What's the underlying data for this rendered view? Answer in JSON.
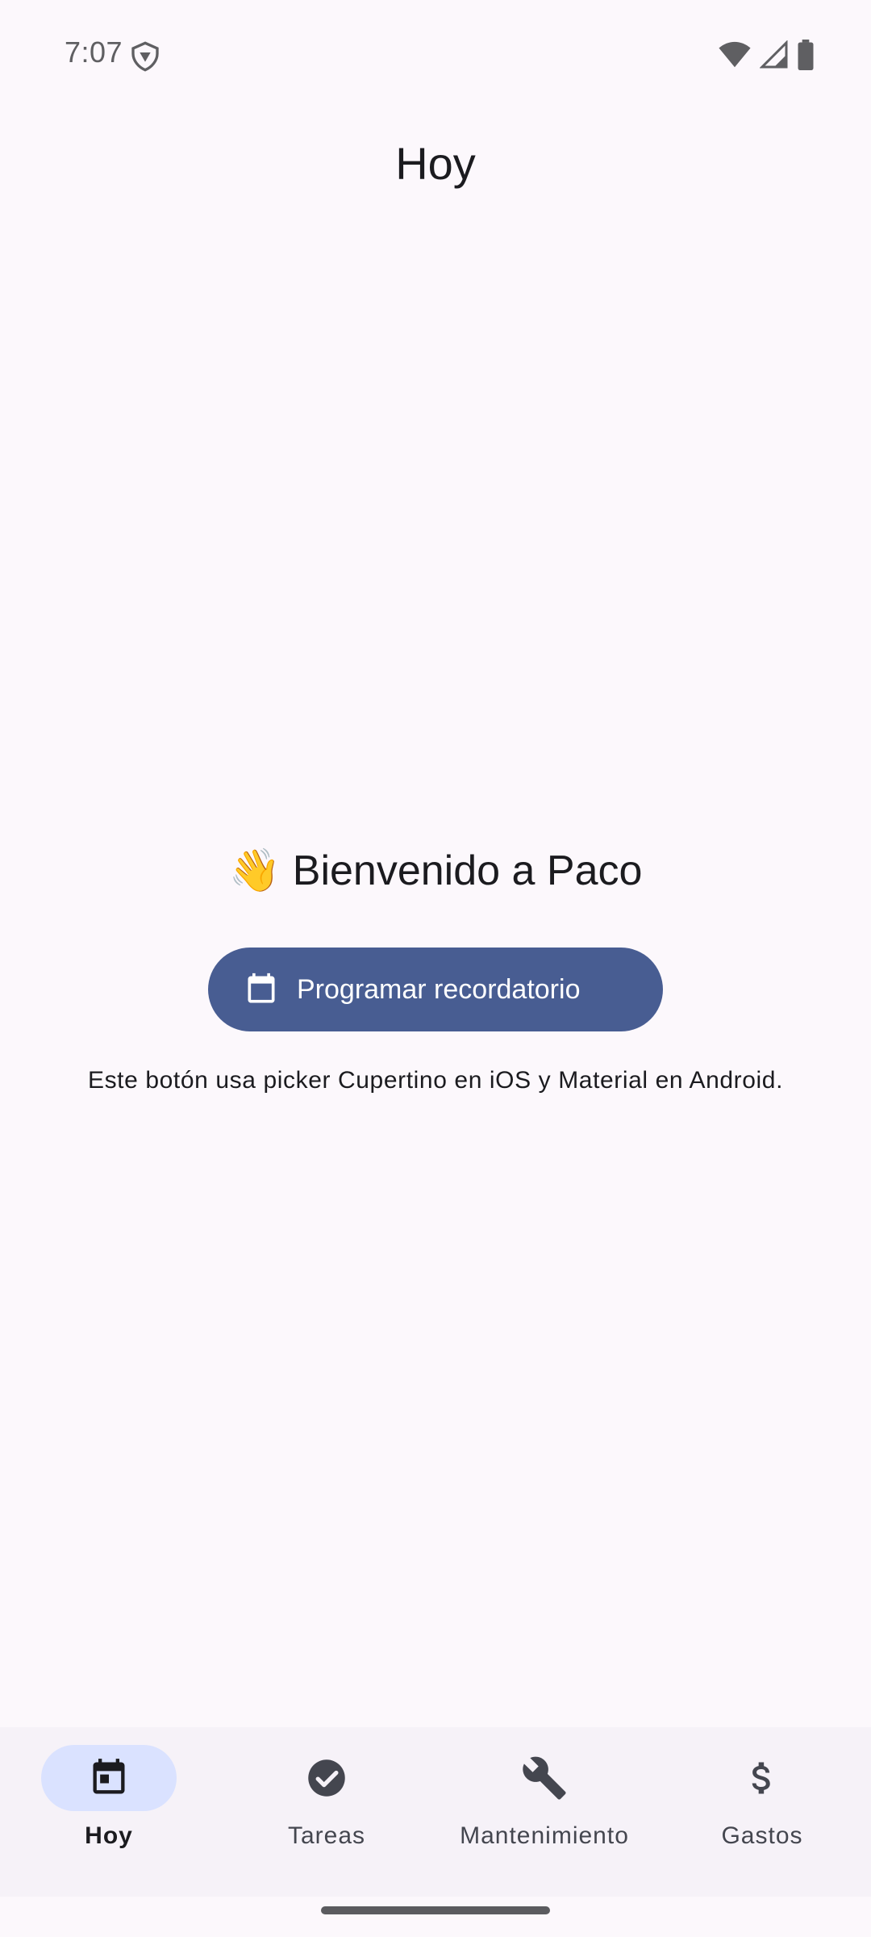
{
  "status_bar": {
    "time": "7:07"
  },
  "app_bar": {
    "title": "Hoy"
  },
  "content": {
    "welcome_emoji": "👋",
    "welcome_text": "Bienvenido a Paco",
    "cta_label": "Programar recordatorio",
    "helper_text": "Este botón usa picker Cupertino en iOS y Material en Android."
  },
  "bottom_nav": {
    "items": [
      {
        "label": "Hoy",
        "icon": "calendar-icon",
        "active": true
      },
      {
        "label": "Tareas",
        "icon": "check-circle-icon",
        "active": false
      },
      {
        "label": "Mantenimiento",
        "icon": "wrench-icon",
        "active": false
      },
      {
        "label": "Gastos",
        "icon": "dollar-icon",
        "active": false
      }
    ]
  },
  "colors": {
    "background": "#fcf8fc",
    "primary": "#485d92",
    "nav_indicator": "#dae2ff",
    "nav_background": "#f6f2f8"
  }
}
